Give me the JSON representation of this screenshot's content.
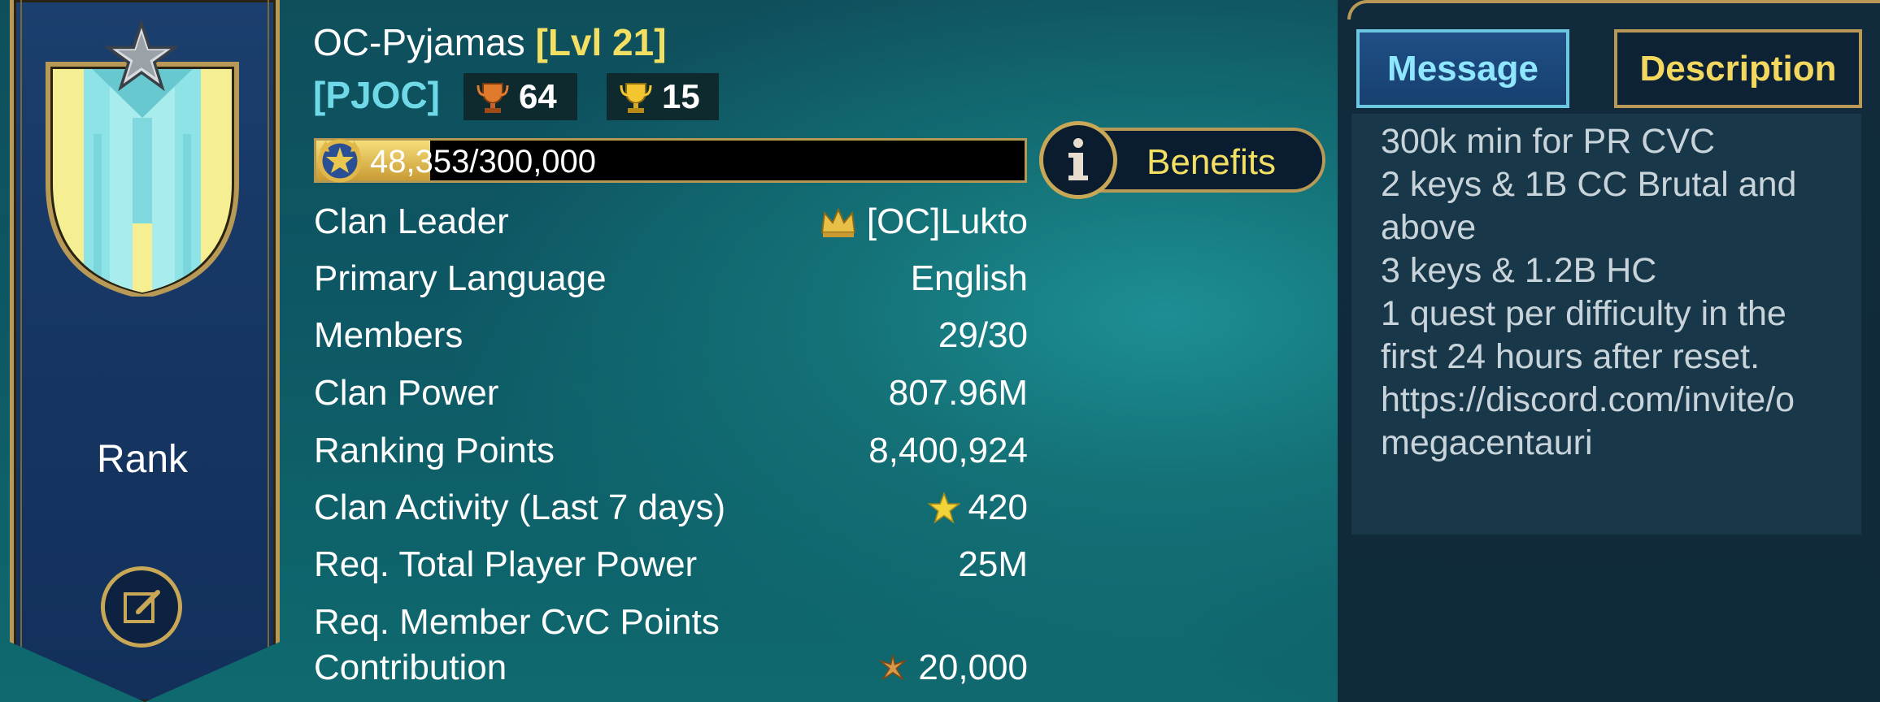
{
  "banner": {
    "rank_label": "Rank",
    "icons": [
      "star-badge-icon",
      "clan-shield-icon",
      "edit-icon"
    ]
  },
  "header": {
    "clan_name": "OC-Pyjamas",
    "level": "[Lvl 21]",
    "tag": "[PJOC]",
    "badges": [
      {
        "icon": "bronze-trophy-icon",
        "value": "64"
      },
      {
        "icon": "gold-trophy-icon",
        "value": "15"
      }
    ]
  },
  "progress": {
    "text": "48,353/300,000",
    "current": 48353,
    "max": 300000,
    "icon": "clan-level-medal-icon"
  },
  "benefits": {
    "label": "Benefits",
    "icon": "info-icon"
  },
  "info": [
    {
      "label": "Clan Leader",
      "value": "[OC]Lukto",
      "icon": "crown-icon"
    },
    {
      "label": "Primary Language",
      "value": "English"
    },
    {
      "label": "Members",
      "value": "29/30"
    },
    {
      "label": "Clan Power",
      "value": "807.96M"
    },
    {
      "label": "Ranking Points",
      "value": "8,400,924"
    },
    {
      "label": "Clan Activity (Last 7 days)",
      "value": "420",
      "icon": "star-icon"
    },
    {
      "label": "Req. Total Player Power",
      "value": "25M"
    },
    {
      "label_line1": "Req. Member CvC Points",
      "label_line2": "Contribution",
      "value": "20,000",
      "icon": "cvc-points-icon"
    }
  ],
  "tabs": {
    "message": "Message",
    "description": "Description"
  },
  "message_lines": [
    "300k min for PR CVC",
    "2 keys & 1B CC Brutal and",
    "above",
    "3 keys & 1.2B HC",
    "1 quest per difficulty in the",
    "first 24 hours after reset.",
    "https://discord.com/invite/o",
    "megacentauri"
  ],
  "colors": {
    "accent_gold": "#f3df62",
    "tag_cyan": "#6fd9e8",
    "frame_gold": "#b89a56",
    "message_tab_text": "#8fe6ff"
  }
}
